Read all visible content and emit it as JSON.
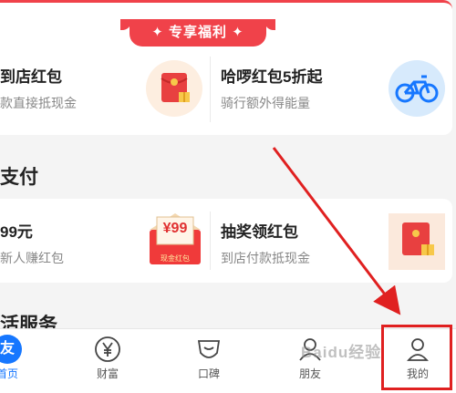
{
  "banner": {
    "label": "✦ 专享福利 ✦"
  },
  "benefits": {
    "left": {
      "title": "到店红包",
      "subtitle": "款直接抵现金"
    },
    "right": {
      "title": "哈啰红包5折起",
      "subtitle": "骑行额外得能量"
    }
  },
  "pay_section": {
    "heading": "支付"
  },
  "pay": {
    "left": {
      "title": "99元",
      "subtitle": "新人赚红包",
      "badge_value": "¥99",
      "badge_caption": "现金红包"
    },
    "right": {
      "title": "抽奖领红包",
      "subtitle": "到店付款抵现金"
    }
  },
  "life_section": {
    "heading": "活服务"
  },
  "tabs": [
    {
      "label": "首页",
      "icon": "home-icon",
      "glyph": "友"
    },
    {
      "label": "财富",
      "icon": "yen-icon"
    },
    {
      "label": "口碑",
      "icon": "koubei-icon"
    },
    {
      "label": "朋友",
      "icon": "friends-icon"
    },
    {
      "label": "我的",
      "icon": "profile-icon"
    }
  ],
  "watermark": {
    "text": "Baidu经验"
  },
  "colors": {
    "accent_red": "#f0424a",
    "tab_blue": "#1677ff",
    "annotation_red": "#e02020"
  }
}
